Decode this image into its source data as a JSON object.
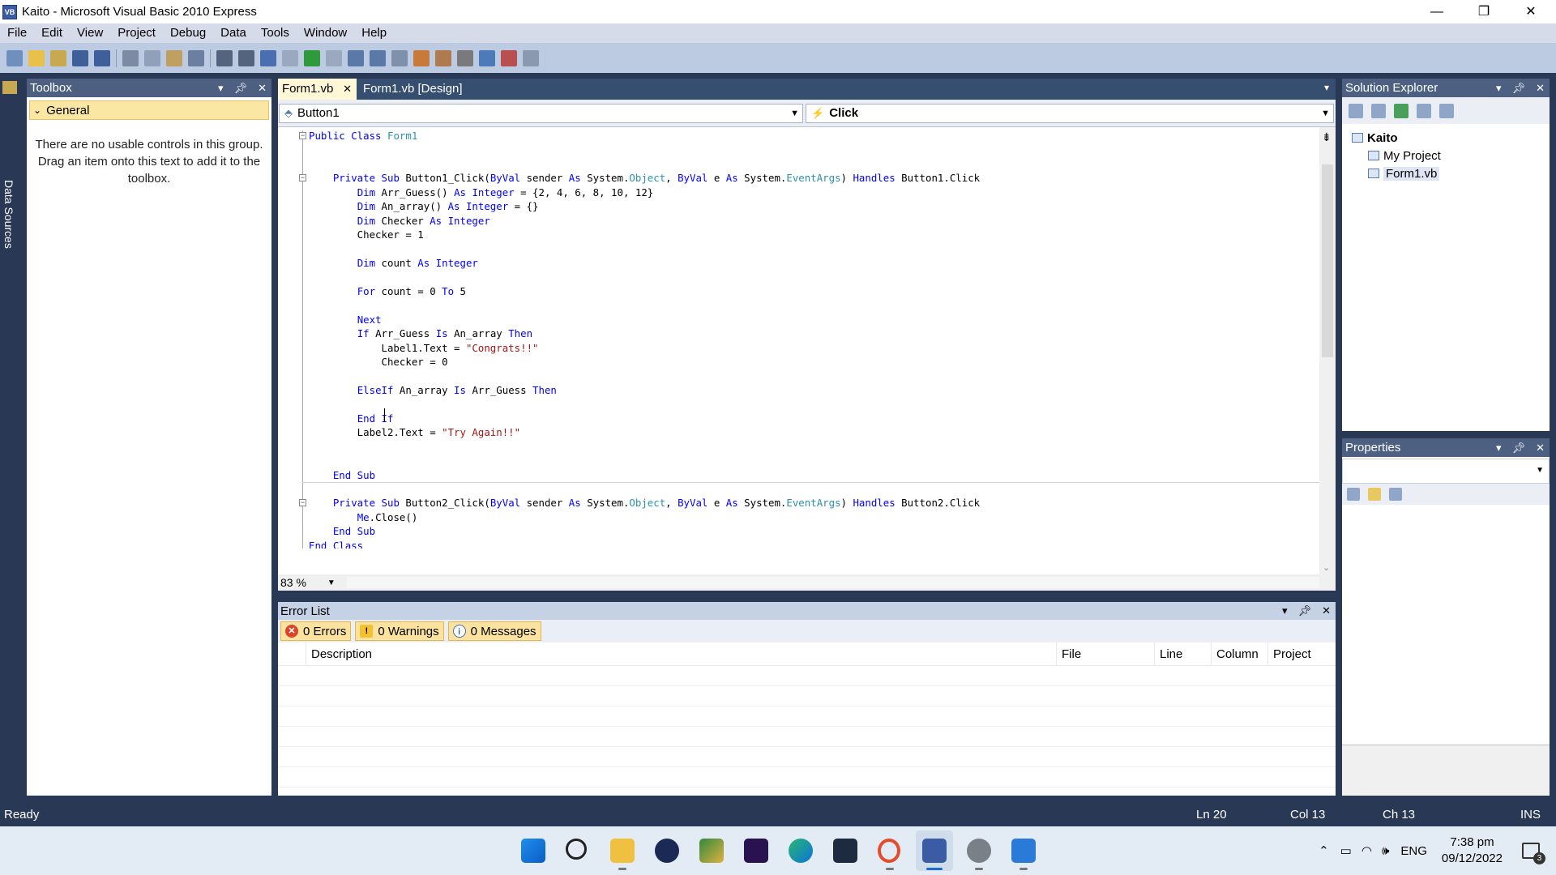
{
  "window": {
    "title": "Kaito - Microsoft Visual Basic 2010 Express",
    "icon_label": "VB",
    "controls": {
      "minimize": "—",
      "restore": "❐",
      "close": "✕"
    }
  },
  "menu": [
    "File",
    "Edit",
    "View",
    "Project",
    "Debug",
    "Data",
    "Tools",
    "Window",
    "Help"
  ],
  "side_strip": {
    "label": "Data Sources"
  },
  "toolbox": {
    "title": "Toolbox",
    "group": "General",
    "empty_message": "There are no usable controls in this group. Drag an item onto this text to add it to the toolbox."
  },
  "tabs": {
    "active": "Form1.vb",
    "inactive": "Form1.vb [Design]"
  },
  "nav": {
    "object": "Button1",
    "event": "Click"
  },
  "code": {
    "lines": [
      [
        [
          "kw",
          "Public Class "
        ],
        [
          "ty",
          "Form1"
        ]
      ],
      [],
      [],
      [
        [
          "",
          "    "
        ],
        [
          "kw",
          "Private Sub "
        ],
        [
          "",
          "Button1_Click("
        ],
        [
          "kw",
          "ByVal "
        ],
        [
          "",
          "sender "
        ],
        [
          "kw",
          "As "
        ],
        [
          "",
          "System."
        ],
        [
          "ty",
          "Object"
        ],
        [
          "",
          ", "
        ],
        [
          "kw",
          "ByVal "
        ],
        [
          "",
          "e "
        ],
        [
          "kw",
          "As "
        ],
        [
          "",
          "System."
        ],
        [
          "ty",
          "EventArgs"
        ],
        [
          "",
          ") "
        ],
        [
          "kw",
          "Handles "
        ],
        [
          "",
          "Button1.Click"
        ]
      ],
      [
        [
          "",
          "        "
        ],
        [
          "kw",
          "Dim "
        ],
        [
          "",
          "Arr_Guess() "
        ],
        [
          "kw",
          "As Integer "
        ],
        [
          "",
          "= {2, 4, 6, 8, 10, 12}"
        ]
      ],
      [
        [
          "",
          "        "
        ],
        [
          "kw",
          "Dim "
        ],
        [
          "",
          "An_array() "
        ],
        [
          "kw",
          "As Integer "
        ],
        [
          "",
          "= {}"
        ]
      ],
      [
        [
          "",
          "        "
        ],
        [
          "kw",
          "Dim "
        ],
        [
          "",
          "Checker "
        ],
        [
          "kw",
          "As Integer"
        ]
      ],
      [
        [
          "",
          "        Checker = 1"
        ]
      ],
      [],
      [
        [
          "",
          "        "
        ],
        [
          "kw",
          "Dim "
        ],
        [
          "",
          "count "
        ],
        [
          "kw",
          "As Integer"
        ]
      ],
      [],
      [
        [
          "",
          "        "
        ],
        [
          "kw",
          "For "
        ],
        [
          "",
          "count = 0 "
        ],
        [
          "kw",
          "To "
        ],
        [
          "",
          "5"
        ]
      ],
      [],
      [
        [
          "",
          "        "
        ],
        [
          "kw",
          "Next"
        ]
      ],
      [
        [
          "",
          "        "
        ],
        [
          "kw",
          "If "
        ],
        [
          "",
          "Arr_Guess "
        ],
        [
          "kw",
          "Is "
        ],
        [
          "",
          "An_array "
        ],
        [
          "kw",
          "Then"
        ]
      ],
      [
        [
          "",
          "            Label1.Text = "
        ],
        [
          "st",
          "\"Congrats!!\""
        ]
      ],
      [
        [
          "",
          "            Checker = 0"
        ]
      ],
      [],
      [
        [
          "",
          "        "
        ],
        [
          "kw",
          "ElseIf "
        ],
        [
          "",
          "An_array "
        ],
        [
          "kw",
          "Is "
        ],
        [
          "",
          "Arr_Guess "
        ],
        [
          "kw",
          "Then"
        ]
      ],
      [],
      [
        [
          "",
          "        "
        ],
        [
          "kw",
          "End If"
        ]
      ],
      [
        [
          "",
          "        Label2.Text = "
        ],
        [
          "st",
          "\"Try Again!!\""
        ]
      ],
      [],
      [],
      [
        [
          "",
          "    "
        ],
        [
          "kw",
          "End Sub"
        ]
      ],
      [],
      [
        [
          "",
          "    "
        ],
        [
          "kw",
          "Private Sub "
        ],
        [
          "",
          "Button2_Click("
        ],
        [
          "kw",
          "ByVal "
        ],
        [
          "",
          "sender "
        ],
        [
          "kw",
          "As "
        ],
        [
          "",
          "System."
        ],
        [
          "ty",
          "Object"
        ],
        [
          "",
          ", "
        ],
        [
          "kw",
          "ByVal "
        ],
        [
          "",
          "e "
        ],
        [
          "kw",
          "As "
        ],
        [
          "",
          "System."
        ],
        [
          "ty",
          "EventArgs"
        ],
        [
          "",
          ") "
        ],
        [
          "kw",
          "Handles "
        ],
        [
          "",
          "Button2.Click"
        ]
      ],
      [
        [
          "",
          "        "
        ],
        [
          "kw",
          "Me"
        ],
        [
          "",
          ".Close()"
        ]
      ],
      [
        [
          "",
          "    "
        ],
        [
          "kw",
          "End Sub"
        ]
      ],
      [
        [
          "kw",
          "End Class"
        ]
      ]
    ]
  },
  "zoom": "83 %",
  "error_list": {
    "title": "Error List",
    "filters": {
      "errors": "0 Errors",
      "warnings": "0 Warnings",
      "messages": "0 Messages"
    },
    "columns": [
      "Description",
      "File",
      "Line",
      "Column",
      "Project"
    ]
  },
  "solution_explorer": {
    "title": "Solution Explorer",
    "tree": {
      "project": "Kaito",
      "my_project": "My Project",
      "file": "Form1.vb"
    }
  },
  "properties": {
    "title": "Properties"
  },
  "status": {
    "text": "Ready",
    "ln": "Ln 20",
    "col": "Col 13",
    "ch": "Ch 13",
    "mode": "INS"
  },
  "taskbar": {
    "language": "ENG",
    "time": "7:38 pm",
    "date": "09/12/2022",
    "notifications": "3"
  },
  "assistant_badge": "G",
  "colors": {
    "ide_frame": "#293955",
    "active_tab": "#fff7d6",
    "keyword": "#0000ff",
    "type": "#2b91af",
    "string": "#a31515"
  }
}
